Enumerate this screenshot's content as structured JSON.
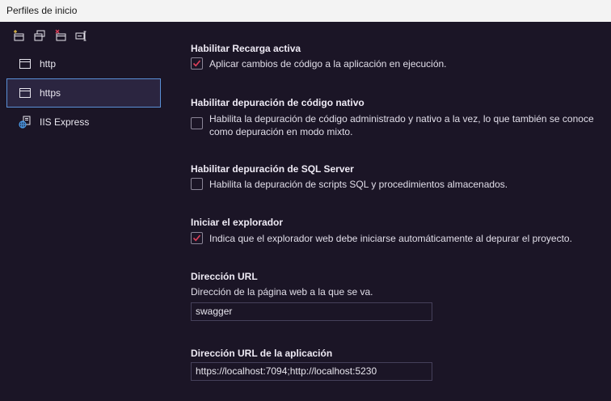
{
  "window": {
    "title": "Perfiles de inicio"
  },
  "toolbar": {
    "icons": [
      "new-profile-icon",
      "copy-profile-icon",
      "delete-profile-icon",
      "rename-profile-icon"
    ]
  },
  "sidebar": {
    "items": [
      {
        "label": "http",
        "icon": "window-icon",
        "selected": false
      },
      {
        "label": "https",
        "icon": "window-icon",
        "selected": true
      },
      {
        "label": "IIS Express",
        "icon": "iis-express-icon",
        "selected": false
      }
    ]
  },
  "settings": {
    "hot_reload": {
      "title": "Habilitar Recarga activa",
      "label": "Aplicar cambios de código a la aplicación en ejecución.",
      "checked": true
    },
    "native_debug": {
      "title": "Habilitar depuración de código nativo",
      "label_line1": "Habilita la depuración de código administrado y nativo a la vez, lo que también se conoce",
      "label_line2": "como depuración en modo mixto.",
      "checked": false
    },
    "sql_debug": {
      "title": "Habilitar depuración de SQL Server",
      "label": "Habilita la depuración de scripts SQL y procedimientos almacenados.",
      "checked": false
    },
    "launch_browser": {
      "title": "Iniciar el explorador",
      "label": "Indica que el explorador web debe iniciarse automáticamente al depurar el proyecto.",
      "checked": true
    },
    "url": {
      "title": "Dirección URL",
      "description": "Dirección de la página web a la que se va.",
      "value": "swagger"
    },
    "app_url": {
      "title": "Dirección URL de la aplicación",
      "value": "https://localhost:7094;http://localhost:5230"
    }
  },
  "colors": {
    "background": "#1b1526",
    "accent_check": "#e0405a",
    "selection_border": "#5a8fd6"
  }
}
